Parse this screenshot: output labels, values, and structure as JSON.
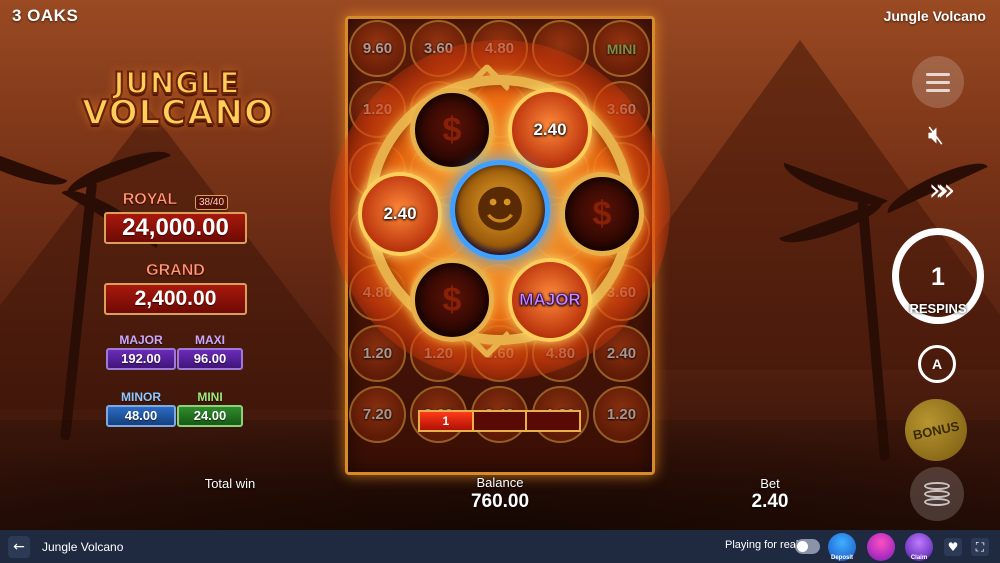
{
  "header": {
    "brand": "3 OAKS",
    "game_title": "Jungle Volcano"
  },
  "logo": {
    "line1": "JUNGLE",
    "line2": "VOLCANO"
  },
  "jackpots": {
    "royal": {
      "label": "ROYAL",
      "progress": "38/40",
      "value": "24,000.00"
    },
    "grand": {
      "label": "GRAND",
      "value": "2,400.00"
    },
    "major": {
      "label": "MAJOR",
      "value": "192.00"
    },
    "maxi": {
      "label": "MAXI",
      "value": "96.00"
    },
    "minor": {
      "label": "MINOR",
      "value": "48.00"
    },
    "mini": {
      "label": "MINI",
      "value": "24.00"
    }
  },
  "reels": {
    "grid": [
      [
        "9.60",
        "3.60",
        "4.80",
        "",
        "MINI"
      ],
      [
        "1.20",
        "",
        "",
        "",
        "3.60"
      ],
      [
        "",
        "",
        "",
        "",
        ""
      ],
      [
        "",
        "",
        "",
        "",
        ""
      ],
      [
        "4.80",
        "",
        "",
        "",
        "3.60"
      ],
      [
        "1.20",
        "1.20",
        "3.60",
        "4.80",
        "2.40"
      ],
      [
        "7.20",
        "3.60",
        "2.40",
        "1.20",
        "1.20"
      ]
    ]
  },
  "wheel": {
    "top_right": "2.40",
    "left": "2.40",
    "bottom_right": "MAJOR"
  },
  "respin_bar": {
    "segments": [
      "1",
      "",
      ""
    ]
  },
  "controls": {
    "respins_count": "1",
    "respins_label": "RESPINS",
    "auto_label": "A",
    "bonus_label": "BONUS"
  },
  "stats": {
    "total_win_label": "Total win",
    "balance_label": "Balance",
    "balance_value": "760.00",
    "bet_label": "Bet",
    "bet_value": "2.40"
  },
  "bottom_bar": {
    "back_icon": "←",
    "title": "Jungle Volcano",
    "play_real_label": "Playing for real",
    "promos": [
      "Deposit",
      "",
      "Claim"
    ]
  },
  "colors": {
    "reel_border": "#d68a2a",
    "bottom_bar": "#1f2940",
    "mask_glow": "#3fa0ff"
  }
}
